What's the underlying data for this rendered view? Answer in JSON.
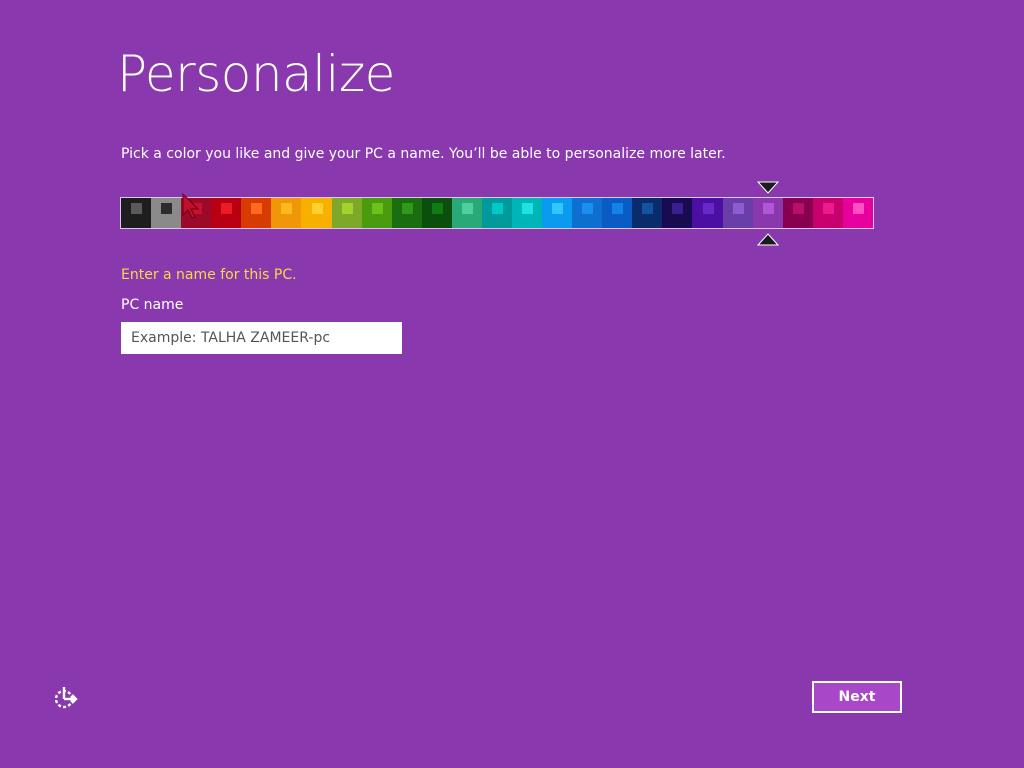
{
  "page": {
    "title": "Personalize",
    "subtitle": "Pick a color you like and give your PC a name. You’ll be able to personalize more later.",
    "background_color": "#8a38ad"
  },
  "color_picker": {
    "selected_index": 21,
    "swatches": [
      {
        "bg": "#1e1e1e",
        "fg": "#5a5a5a"
      },
      {
        "bg": "#8a8a8a",
        "fg": "#2c2c2c"
      },
      {
        "bg": "#9c0a2a",
        "fg": "#c8102f"
      },
      {
        "bg": "#b80012",
        "fg": "#ea1c24"
      },
      {
        "bg": "#d83b01",
        "fg": "#ff6a1f"
      },
      {
        "bg": "#f09609",
        "fg": "#ffb81c"
      },
      {
        "bg": "#f7b000",
        "fg": "#ffd02e"
      },
      {
        "bg": "#7ea82a",
        "fg": "#a3d22c"
      },
      {
        "bg": "#4a9c0e",
        "fg": "#6cc21b"
      },
      {
        "bg": "#1a6e10",
        "fg": "#2f9a1a"
      },
      {
        "bg": "#0c4f0c",
        "fg": "#127c14"
      },
      {
        "bg": "#2aa877",
        "fg": "#4ed09a"
      },
      {
        "bg": "#009a9a",
        "fg": "#00c9c9"
      },
      {
        "bg": "#00b5b5",
        "fg": "#1ee2e2"
      },
      {
        "bg": "#0a9bf0",
        "fg": "#34c4ff"
      },
      {
        "bg": "#0f6fd0",
        "fg": "#1b8ff0"
      },
      {
        "bg": "#0a5bc4",
        "fg": "#1482ea"
      },
      {
        "bg": "#0a2c6a",
        "fg": "#12549f"
      },
      {
        "bg": "#190b52",
        "fg": "#3a208e"
      },
      {
        "bg": "#4b0fa3",
        "fg": "#6a28c8"
      },
      {
        "bg": "#6a3ea8",
        "fg": "#8e5cd0"
      },
      {
        "bg": "#8a38ad",
        "fg": "#b056d6"
      },
      {
        "bg": "#8a0050",
        "fg": "#b80e6c"
      },
      {
        "bg": "#c7006e",
        "fg": "#ec1a8e"
      },
      {
        "bg": "#e8009f",
        "fg": "#ff4fc6"
      }
    ]
  },
  "name_section": {
    "prompt": "Enter a name for this PC.",
    "field_label": "PC name",
    "placeholder": "Example: TALHA ZAMEER-pc",
    "value": ""
  },
  "footer": {
    "ease_of_access_icon": "ease-of-access-icon",
    "next_label": "Next"
  }
}
